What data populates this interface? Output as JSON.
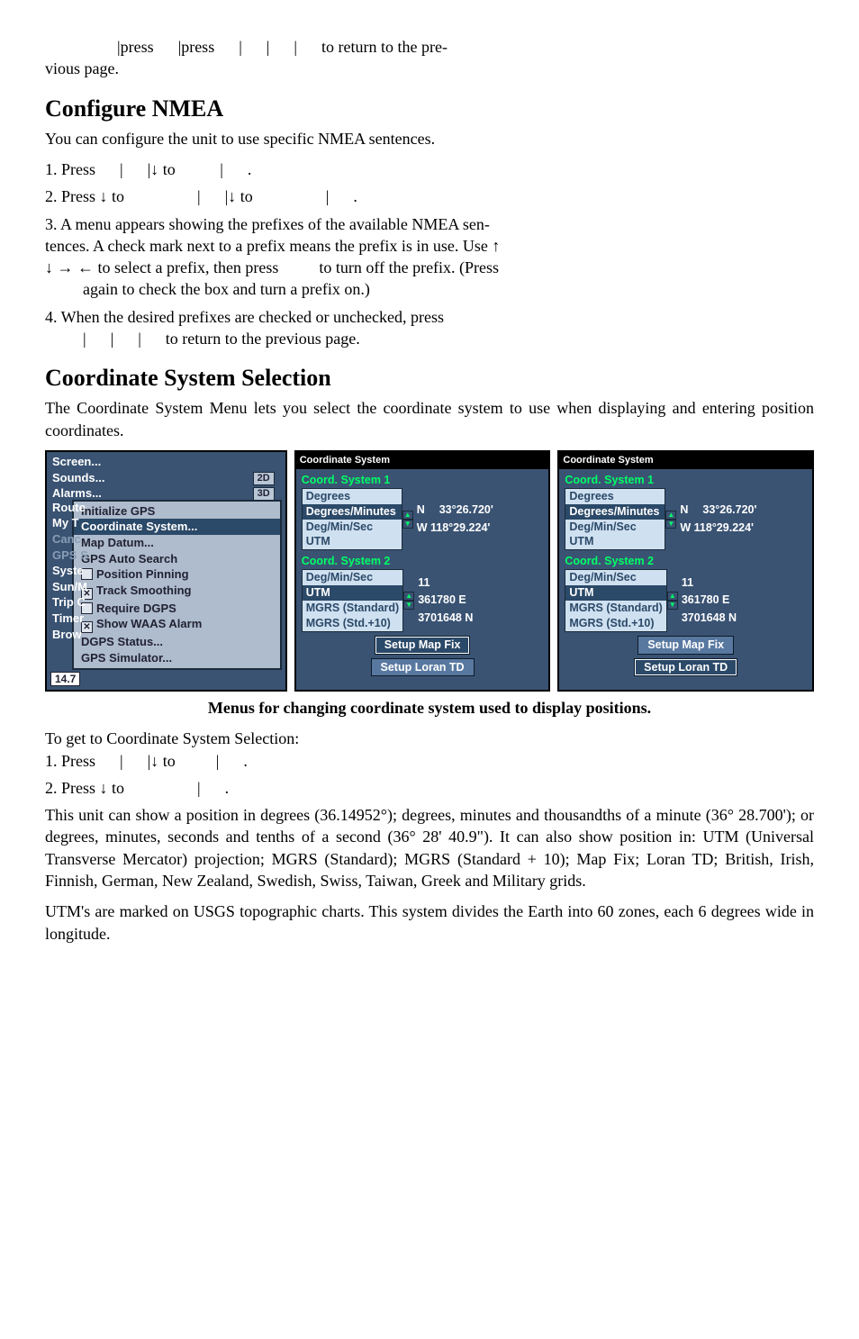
{
  "intro_line": "|press   |press   |   |   |   to return to the pre-",
  "intro_line2": "vious page.",
  "h_nmea": "Configure NMEA",
  "nmea_p": "You can configure the unit to use specific NMEA sentences.",
  "nmea_s1": "1. Press   |   |↓ to     |   .",
  "nmea_s2": "2. Press ↓ to      |   |↓ to      |   .",
  "nmea_s3a": "3. A menu appears showing the prefixes of the available NMEA sen-",
  "nmea_s3b": "tences. A check mark next to a prefix means the prefix is in use. Use ↑",
  "nmea_s3c": "↓ → ← to select a prefix, then press    to turn off the prefix. (Press",
  "nmea_s3d": "again to check the box and turn a prefix on.)",
  "nmea_s4a": "4. When the desired prefixes are checked or unchecked, press",
  "nmea_s4b": "|   |   |   to return to the previous page.",
  "h_coord": "Coordinate System Selection",
  "coord_p": "The Coordinate System Menu lets you select the coordinate system to use when displaying and entering position coordinates.",
  "menu": {
    "items_top": [
      "Screen...",
      "Sounds...",
      "Alarms...",
      "Route",
      "My T",
      "Canc",
      "GPS S",
      "Syste",
      "Sun/M",
      "Trip C",
      "Timer",
      "Brow"
    ],
    "badge1": "2D",
    "badge2": "3D",
    "sub": [
      "Initialize GPS",
      "Coordinate System...",
      "Map Datum...",
      "GPS Auto Search",
      "Position Pinning",
      "Track Smoothing",
      "Require DGPS",
      "Show WAAS Alarm",
      "DGPS Status...",
      "GPS Simulator..."
    ],
    "bottom_num": "14.7"
  },
  "panel": {
    "title": "Coordinate System",
    "sys1": "Coord. System 1",
    "sys2": "Coord. System 2",
    "opts1": [
      "Degrees",
      "Degrees/Minutes",
      "Deg/Min/Sec",
      "UTM"
    ],
    "opts2": [
      "Deg/Min/Sec",
      "UTM",
      "MGRS (Standard)",
      "MGRS (Std.+10)"
    ],
    "lat": "N  33°26.720'",
    "lon": "W 118°29.224'",
    "utm_e": "361780 E",
    "utm_n": "3701648 N",
    "utm_z": "11",
    "btn_map": "Setup Map Fix",
    "btn_loran": "Setup Loran TD"
  },
  "caption": "Menus for changing coordinate system used to display positions.",
  "to_get": "To get to Coordinate System Selection:",
  "cs_s1": "1. Press   |   |↓ to    |   .",
  "cs_s2": "2. Press ↓ to      |   .",
  "para1": "This unit can show a position in degrees (36.14952°); degrees, minutes and thousandths of a minute (36° 28.700'); or degrees, minutes, seconds and tenths of a second (36° 28' 40.9\"). It can also show position in: UTM (Universal Transverse Mercator) projection; MGRS (Standard); MGRS (Standard + 10); Map Fix; Loran TD; British, Irish, Finnish, German, New Zealand, Swedish, Swiss, Taiwan, Greek and Military grids.",
  "para2": "UTM's are marked on USGS topographic charts. This system divides the Earth into 60 zones, each 6 degrees wide in longitude."
}
